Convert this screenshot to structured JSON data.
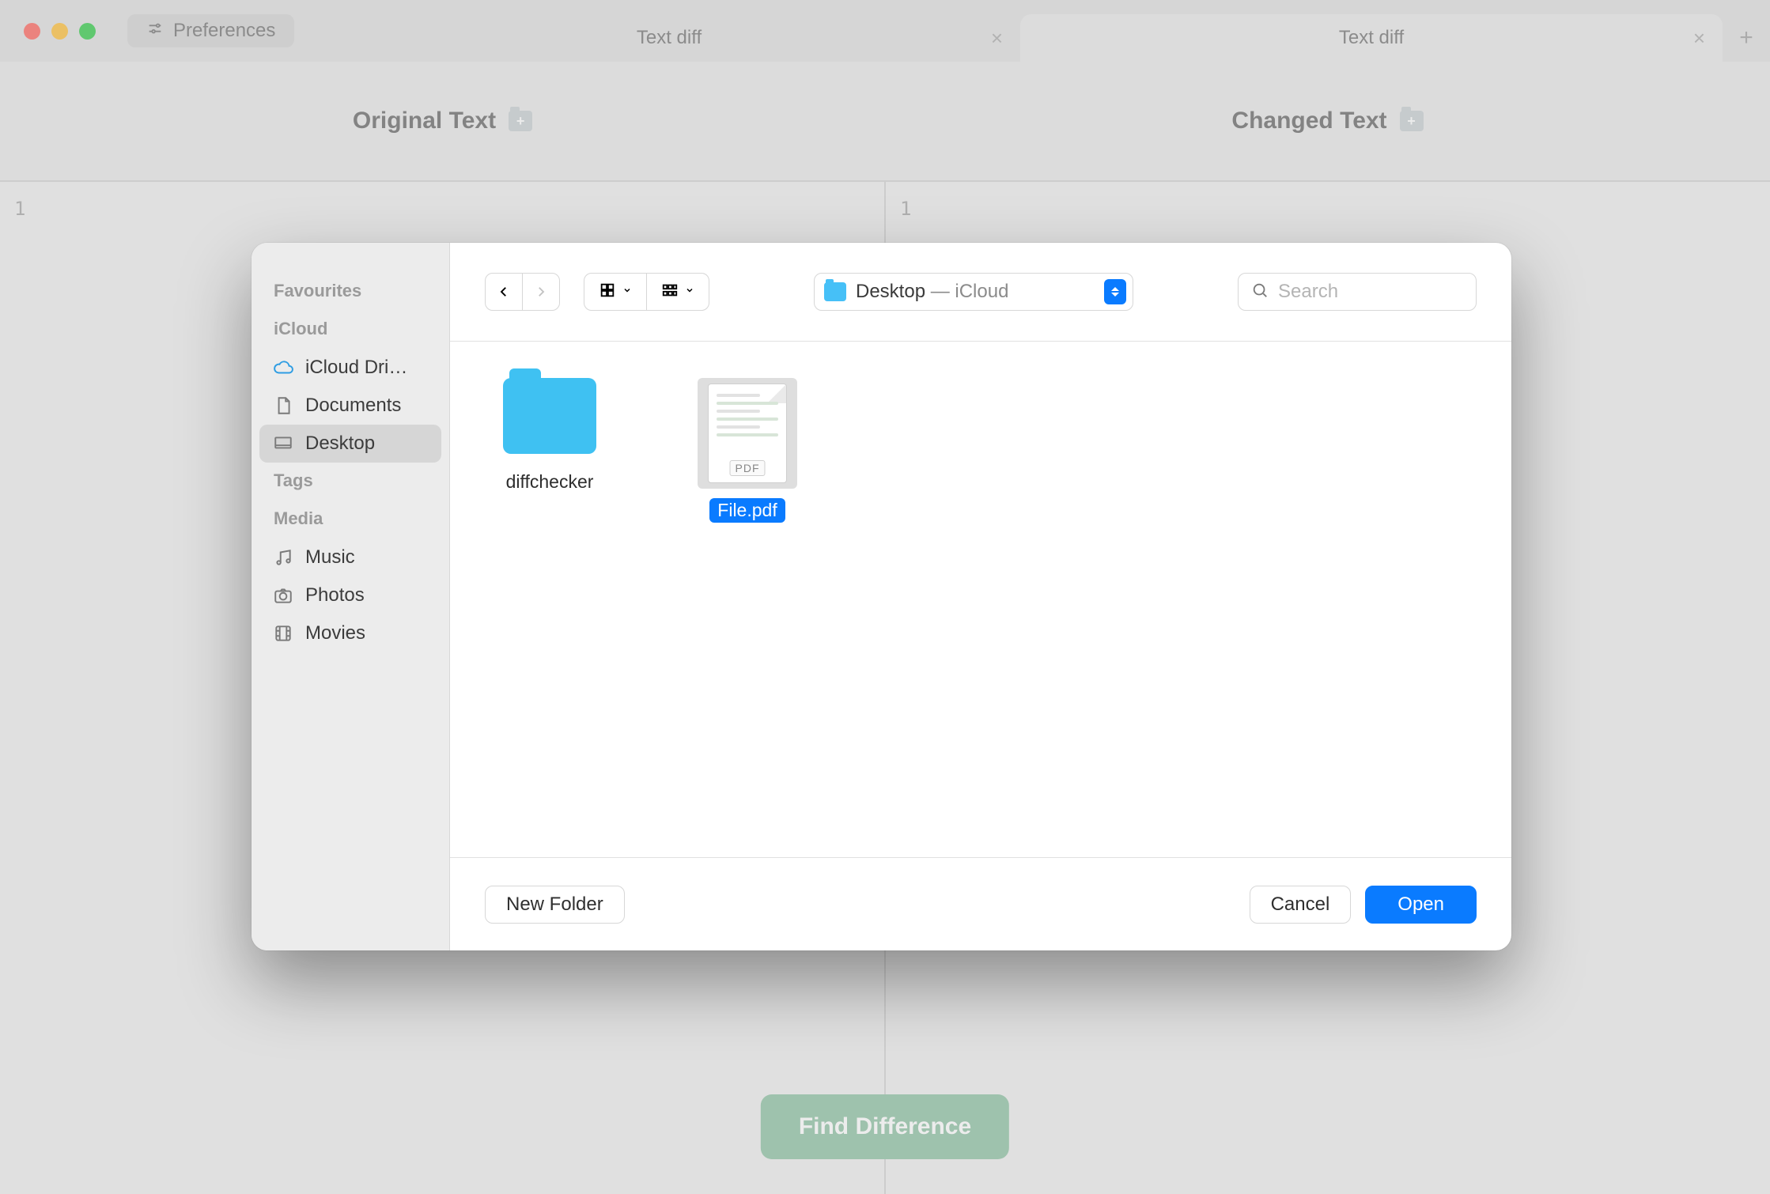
{
  "window": {
    "preferences_label": "Preferences",
    "tabs": [
      {
        "label": "Text diff",
        "active": false
      },
      {
        "label": "Text diff",
        "active": true
      }
    ]
  },
  "panels": {
    "left_label": "Original Text",
    "right_label": "Changed Text",
    "left_line": "1",
    "right_line": "1"
  },
  "action_button": "Find Difference",
  "dialog": {
    "sidebar": {
      "sections": {
        "favourites_label": "Favourites",
        "icloud_label": "iCloud",
        "tags_label": "Tags",
        "media_label": "Media"
      },
      "icloud_items": [
        {
          "label": "iCloud Dri…",
          "icon": "cloud",
          "selected": false
        },
        {
          "label": "Documents",
          "icon": "doc",
          "selected": false
        },
        {
          "label": "Desktop",
          "icon": "desktop",
          "selected": true
        }
      ],
      "media_items": [
        {
          "label": "Music",
          "icon": "music"
        },
        {
          "label": "Photos",
          "icon": "photo"
        },
        {
          "label": "Movies",
          "icon": "movie"
        }
      ]
    },
    "toolbar": {
      "location_primary": "Desktop",
      "location_secondary": " — iCloud",
      "search_placeholder": "Search"
    },
    "files": [
      {
        "name": "diffchecker",
        "type": "folder",
        "selected": false
      },
      {
        "name": "File.pdf",
        "type": "pdf",
        "selected": true,
        "badge": "PDF"
      }
    ],
    "buttons": {
      "new_folder": "New Folder",
      "cancel": "Cancel",
      "open": "Open"
    }
  }
}
